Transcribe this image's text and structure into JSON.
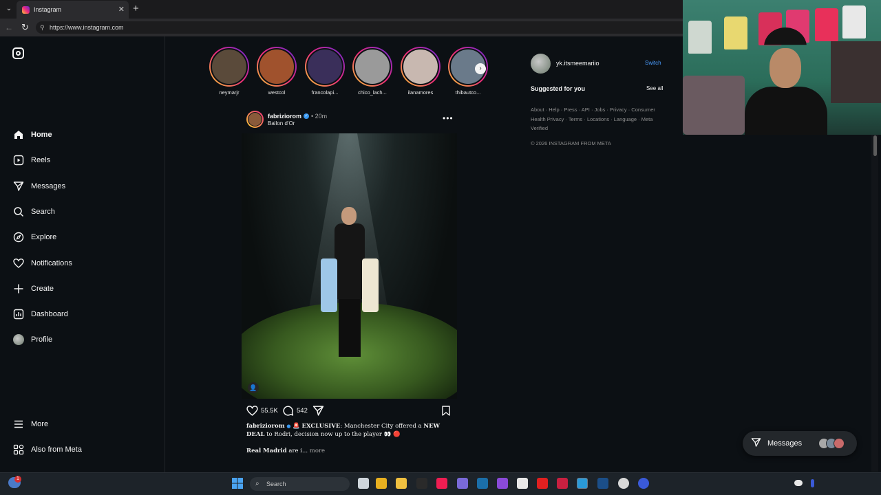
{
  "browser": {
    "tab_title": "Instagram",
    "tab_close": "✕",
    "new_tab": "+",
    "url": "https://www.instagram.com"
  },
  "sidebar": {
    "items": [
      {
        "label": "Home",
        "icon": "home-icon"
      },
      {
        "label": "Reels",
        "icon": "reels-icon"
      },
      {
        "label": "Messages",
        "icon": "messages-icon"
      },
      {
        "label": "Search",
        "icon": "search-icon"
      },
      {
        "label": "Explore",
        "icon": "explore-icon"
      },
      {
        "label": "Notifications",
        "icon": "heart-icon"
      },
      {
        "label": "Create",
        "icon": "plus-icon"
      },
      {
        "label": "Dashboard",
        "icon": "dashboard-icon"
      },
      {
        "label": "Profile",
        "icon": "avatar"
      }
    ],
    "more": "More",
    "also_from_meta": "Also from Meta"
  },
  "stories": [
    {
      "name": "neymarjr",
      "color": "#5a4a3a"
    },
    {
      "name": "westcol",
      "color": "#a0522d"
    },
    {
      "name": "francolapi...",
      "color": "#3a2f5a"
    },
    {
      "name": "chico_lach...",
      "color": "#9a9a9a"
    },
    {
      "name": "ilanamores",
      "color": "#c8b8b0"
    },
    {
      "name": "thibautco...",
      "color": "#6a7a8a"
    }
  ],
  "post": {
    "username": "fabriziorom",
    "verified": "✓",
    "time": "• 20m",
    "subtitle": "Ballon d'Or",
    "likes": "55.5K",
    "comments": "542",
    "caption_user": "fabriziorom",
    "caption_exclusive": "EXCLUSIVE",
    "caption_part1": ": Manchester City offered a ",
    "caption_deal": "NEW DEAL",
    "caption_part2": " to Rodri, decision now up to the player 👀 🔴",
    "caption_line2_bold": "Real Madrid",
    "caption_line2": " are i...",
    "more": "more"
  },
  "right": {
    "username": "yk.itsmeemariio",
    "switch": "Switch",
    "suggested": "Suggested for you",
    "see_all": "See all",
    "footer_links": "About · Help · Press · API · Jobs · Privacy · Consumer Health Privacy · Terms · Locations · Language · Meta Verified",
    "copyright": "© 2026 INSTAGRAM FROM META"
  },
  "messages_pill": {
    "label": "Messages"
  },
  "taskbar": {
    "search_placeholder": "Search",
    "notification_count": "1"
  },
  "colors": {
    "background": "#0c1014",
    "accent_link": "#4a9dff",
    "verified": "#3897f0"
  }
}
